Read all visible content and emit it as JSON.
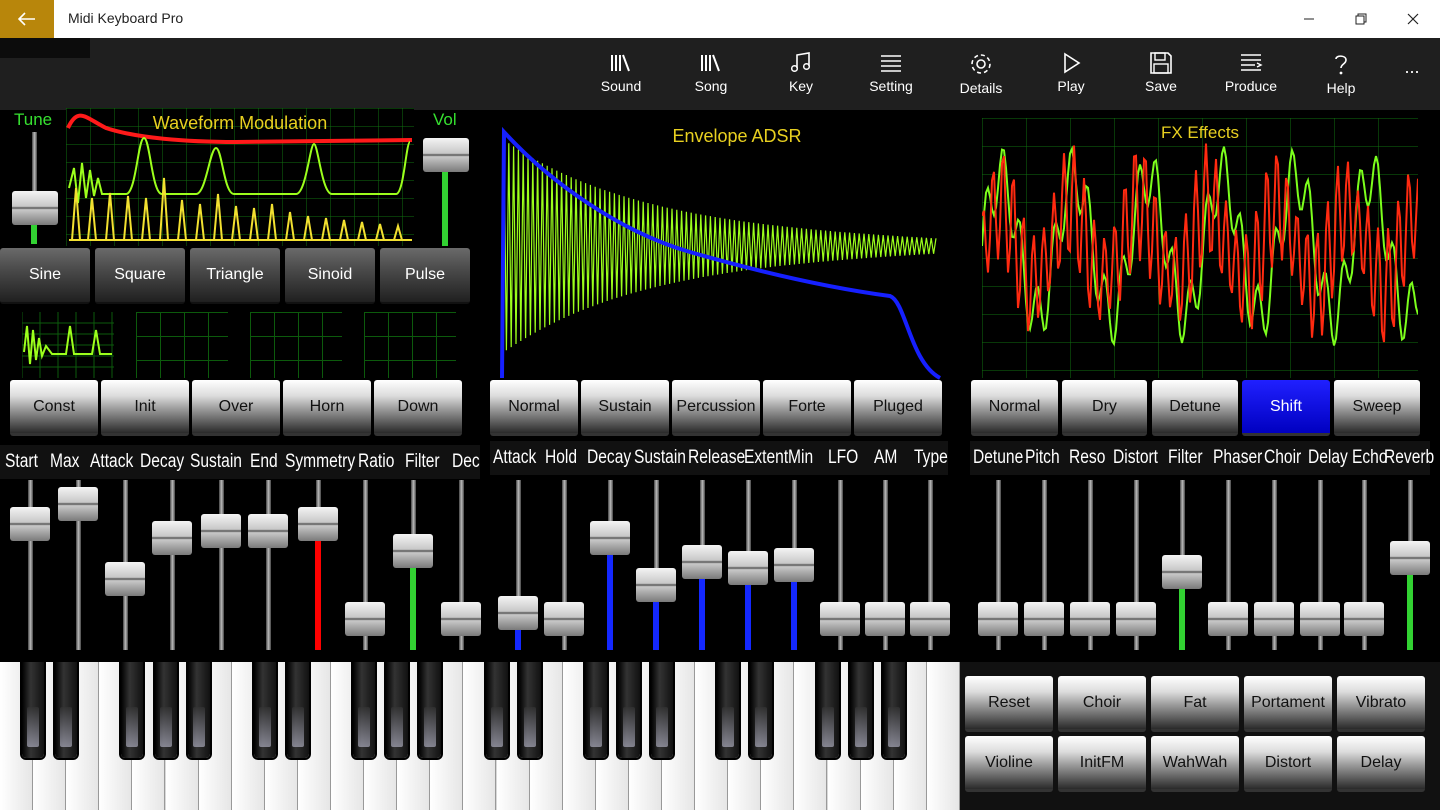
{
  "window": {
    "title": "Midi Keyboard Pro"
  },
  "toolbar": {
    "items": [
      {
        "label": "Sound",
        "icon": "library-icon"
      },
      {
        "label": "Song",
        "icon": "library-icon"
      },
      {
        "label": "Key",
        "icon": "music-note-icon"
      },
      {
        "label": "Setting",
        "icon": "list-icon"
      },
      {
        "label": "Details",
        "icon": "gear-icon"
      },
      {
        "label": "Play",
        "icon": "play-icon"
      },
      {
        "label": "Save",
        "icon": "save-icon"
      },
      {
        "label": "Produce",
        "icon": "produce-icon"
      },
      {
        "label": "Help",
        "icon": "help-icon"
      }
    ],
    "more": "..."
  },
  "waveform": {
    "title": "Waveform Modulation",
    "tune_label": "Tune",
    "vol_label": "Vol",
    "tune_level": 0.25,
    "vol_level": 0.9,
    "wave_buttons": [
      "Sine",
      "Square",
      "Triangle",
      "Sinoid",
      "Pulse"
    ],
    "preset_buttons": [
      "Const",
      "Init",
      "Over",
      "Horn",
      "Down"
    ],
    "params": [
      "Start",
      "Max",
      "Attack",
      "Decay",
      "Sustain",
      "End",
      "Symmetry",
      "Ratio",
      "Filter",
      "Dec"
    ],
    "levels": [
      0.8,
      0.95,
      0.4,
      0.7,
      0.75,
      0.75,
      0.8,
      0.1,
      0.6,
      0.1
    ]
  },
  "envelope": {
    "title": "Envelope ADSR",
    "buttons": [
      "Normal",
      "Sustain",
      "Percussion",
      "Forte",
      "Pluged"
    ],
    "params": [
      "Attack",
      "Hold",
      "Decay",
      "Sustain",
      "Release",
      "Extent",
      "Min",
      "LFO",
      "AM",
      "Type"
    ],
    "levels": [
      0.15,
      0.1,
      0.7,
      0.35,
      0.52,
      0.48,
      0.5,
      0.1,
      0.1,
      0.1
    ]
  },
  "fx": {
    "title": "FX Effects",
    "buttons": [
      "Normal",
      "Dry",
      "Detune",
      "Shift",
      "Sweep"
    ],
    "active_button": "Shift",
    "params": [
      "Detune",
      "Pitch",
      "Reso",
      "Distort",
      "Filter",
      "Phaser",
      "Choir",
      "Delay",
      "Echo",
      "Reverb"
    ],
    "levels": [
      0.1,
      0.1,
      0.1,
      0.1,
      0.45,
      0.1,
      0.1,
      0.1,
      0.1,
      0.55
    ]
  },
  "presets": {
    "row1": [
      "Reset",
      "Choir",
      "Fat",
      "Portament",
      "Vibrato"
    ],
    "row2": [
      "Violine",
      "InitFM",
      "WahWah",
      "Distort",
      "Delay"
    ]
  },
  "colors": {
    "accent": "#b8860b",
    "waveform_title": "#e8d020",
    "label_green": "#36e030",
    "active_blue": "#0000ff",
    "fill_red": "#ff0000",
    "fill_green": "#32d232",
    "fill_blue": "#1428ff"
  }
}
